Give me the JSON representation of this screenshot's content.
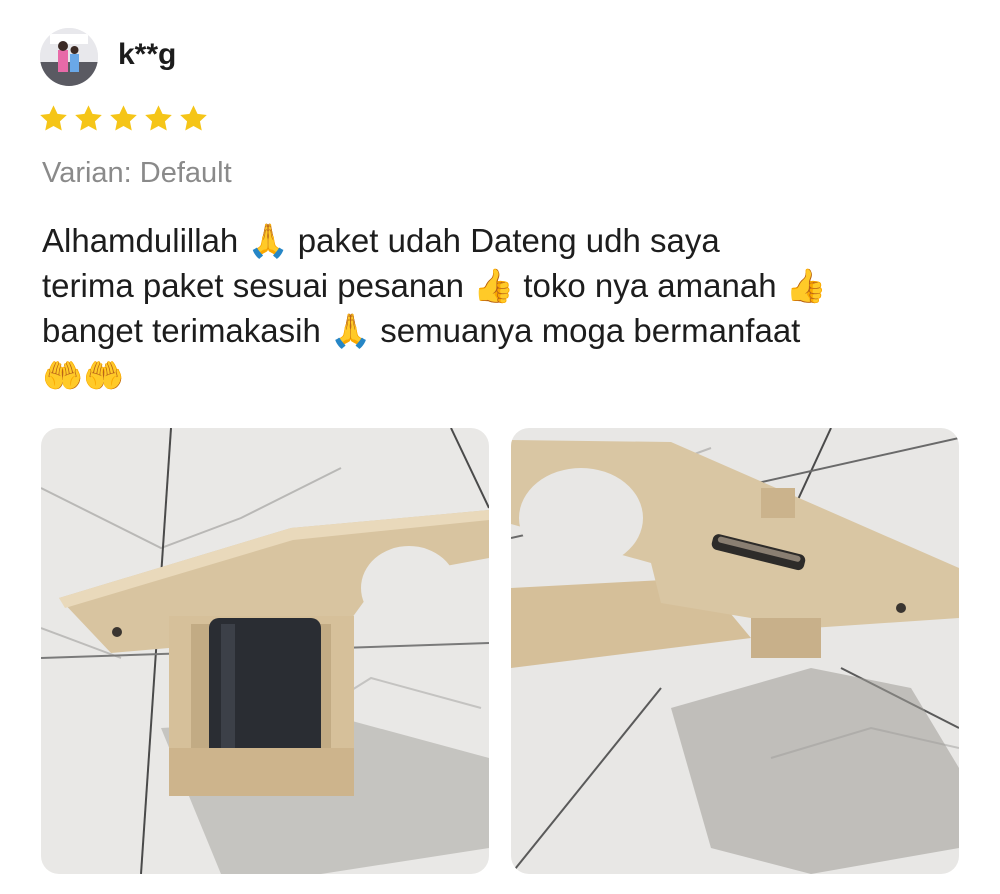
{
  "user": {
    "name": "k**g",
    "avatar_icon": "avatar-icon"
  },
  "rating": {
    "value": 5,
    "max": 5,
    "color": "#f5c518"
  },
  "variant": "Varian: Default",
  "review": {
    "line1_a": "Alhamdulillah",
    "line1_b": "paket udah Dateng udh saya",
    "line2_a": "terima paket sesuai pesanan",
    "line2_b": "toko nya amanah",
    "line3_a": "banget terimakasih",
    "line3_b": "semuanya moga bermanfaat",
    "emoji_pray": "🙏",
    "emoji_thumb": "👍",
    "emoji_hands": "🤲🤲"
  },
  "photos": [
    {
      "alt": "wooden holder with black pipe",
      "icon": "product-photo"
    },
    {
      "alt": "wooden holder side view",
      "icon": "product-photo"
    }
  ]
}
